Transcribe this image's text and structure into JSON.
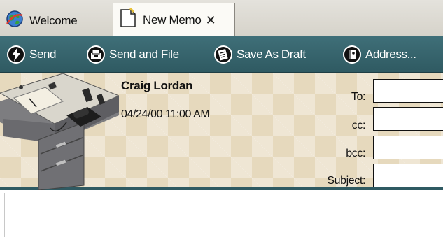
{
  "tabs": [
    {
      "label": "Welcome",
      "icon": "globe-icon",
      "active": false
    },
    {
      "label": "New Memo",
      "icon": "memo-page-icon",
      "active": true,
      "close_label": "✕"
    }
  ],
  "toolbar": {
    "send_label": "Send",
    "send_and_file_label": "Send and File",
    "save_as_draft_label": "Save As Draft",
    "address_label": "Address..."
  },
  "memo": {
    "sender": "Craig Lordan",
    "date": "04/24/00 11:00 AM",
    "to_label": "To:",
    "cc_label": "cc:",
    "bcc_label": "bcc:",
    "subject_label": "Subject:",
    "to_value": "",
    "cc_value": "",
    "bcc_value": "",
    "subject_value": "",
    "body_value": ""
  },
  "colors": {
    "toolbar": "#2f5a62",
    "header_bg": "#e6d9bd",
    "tabstrip": "#d6d3ca"
  }
}
